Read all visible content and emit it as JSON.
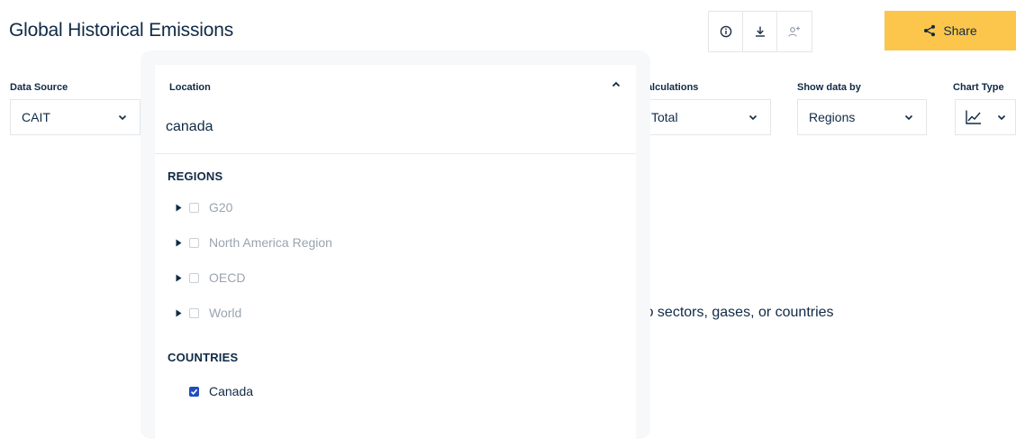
{
  "header": {
    "title": "Global Historical Emissions",
    "share_label": "Share"
  },
  "icons": {
    "info": "info-icon",
    "download": "download-icon",
    "add_user": "add-user-icon",
    "share": "share-icon"
  },
  "filters": {
    "data_source": {
      "label": "Data Source",
      "value": "CAIT"
    },
    "location": {
      "label": "Location",
      "search_value": "canada"
    },
    "calculations": {
      "label": "Calculations",
      "value": "Total"
    },
    "show_data_by": {
      "label": "Show data by",
      "value": "Regions"
    },
    "chart_type": {
      "label": "Chart Type",
      "icon": "line-chart-icon"
    }
  },
  "dropdown": {
    "regions_title": "REGIONS",
    "regions": [
      {
        "label": "G20",
        "checked": false
      },
      {
        "label": "North America Region",
        "checked": false
      },
      {
        "label": "OECD",
        "checked": false
      },
      {
        "label": "World",
        "checked": false
      }
    ],
    "countries_title": "COUNTRIES",
    "countries": [
      {
        "label": "Canada",
        "checked": true
      }
    ]
  },
  "background_message": "\" to sectors, gases, or countries",
  "colors": {
    "accent": "#fcc64c",
    "text": "#0f2a45",
    "checkbox_checked": "#1f4fbf",
    "muted": "#9aa4ae"
  }
}
